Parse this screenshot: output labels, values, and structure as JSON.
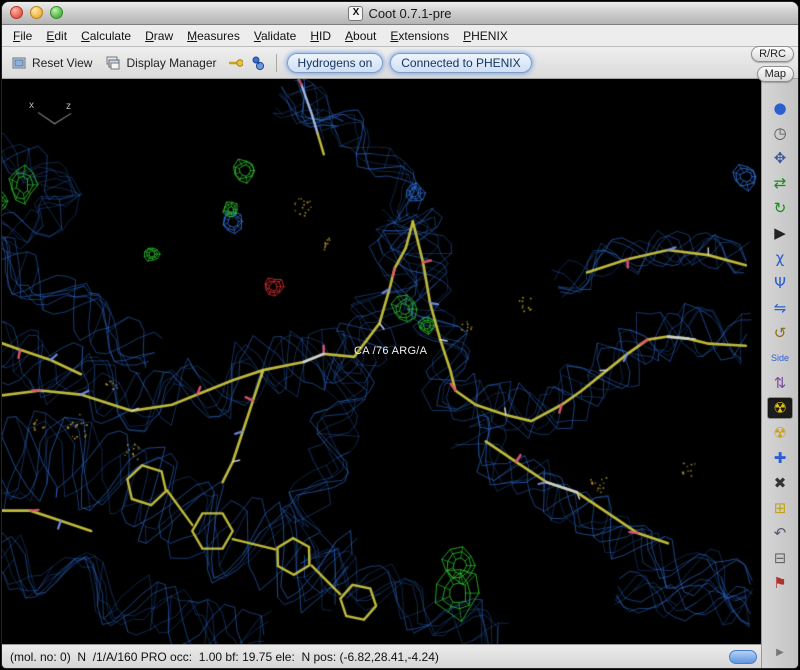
{
  "window": {
    "title": "Coot 0.7.1-pre"
  },
  "menubar": {
    "items": [
      {
        "name": "menu-file",
        "label": "File"
      },
      {
        "name": "menu-edit",
        "label": "Edit"
      },
      {
        "name": "menu-calculate",
        "label": "Calculate"
      },
      {
        "name": "menu-draw",
        "label": "Draw"
      },
      {
        "name": "menu-measures",
        "label": "Measures"
      },
      {
        "name": "menu-validate",
        "label": "Validate"
      },
      {
        "name": "menu-hid",
        "label": "HID"
      },
      {
        "name": "menu-about",
        "label": "About"
      },
      {
        "name": "menu-extensions",
        "label": "Extensions"
      },
      {
        "name": "menu-phenix",
        "label": "PHENIX"
      }
    ]
  },
  "toolbar": {
    "reset_view": "Reset View",
    "display_manager": "Display Manager",
    "hydrogens_toggle": "Hydrogens on",
    "phenix_status": "Connected to PHENIX"
  },
  "side_buttons": {
    "rrc": "R/RC",
    "map": "Map"
  },
  "right_toolbar": {
    "items": [
      {
        "name": "map-sphere-icon",
        "glyph": "●",
        "color": "#2b5fd0"
      },
      {
        "name": "clock-icon",
        "glyph": "◷",
        "color": "#555555"
      },
      {
        "name": "move-zone-icon",
        "glyph": "✥",
        "color": "#3b5998"
      },
      {
        "name": "real-space-refine-icon",
        "glyph": "⇄",
        "color": "#1a8a1a"
      },
      {
        "name": "regularize-zone-icon",
        "glyph": "↻",
        "color": "#1a8a1a"
      },
      {
        "name": "pointer-icon",
        "glyph": "▶",
        "color": "#222222"
      },
      {
        "name": "chi-angles-icon",
        "glyph": "χ",
        "color": "#2b5fd0"
      },
      {
        "name": "rotamers-icon",
        "glyph": "Ψ",
        "color": "#2b5fd0"
      },
      {
        "name": "flip-peptide-icon",
        "glyph": "⇋",
        "color": "#2b5fd0"
      },
      {
        "name": "backrub-rotamer-icon",
        "glyph": "↺",
        "color": "#8a6d1a"
      },
      {
        "name": "side-chain-180-icon",
        "glyph": "Side",
        "color": "#2b5fd0"
      },
      {
        "name": "mutate-icon",
        "glyph": "⇅",
        "color": "#7a4aa0"
      },
      {
        "name": "refinement-active-icon",
        "glyph": "☢",
        "color": "#e3c11c",
        "bg": "#1c1c1c",
        "active": true
      },
      {
        "name": "radiation-icon",
        "glyph": "☢",
        "color": "#caa11b"
      },
      {
        "name": "add-terminal-residue-icon",
        "glyph": "✚",
        "color": "#2b5fd0"
      },
      {
        "name": "delete-item-icon",
        "glyph": "✖",
        "color": "#333333"
      },
      {
        "name": "add-atom-icon",
        "glyph": "⊞",
        "color": "#c2a21a"
      },
      {
        "name": "undo-icon",
        "glyph": "↶",
        "color": "#555577"
      },
      {
        "name": "trash-icon",
        "glyph": "⊟",
        "color": "#666666"
      },
      {
        "name": "display-flag-icon",
        "glyph": "⚑",
        "color": "#b03030"
      },
      {
        "name": "toolbar-overflow-icon",
        "glyph": "▶",
        "color": "#777777",
        "overflow": true
      }
    ]
  },
  "canvas": {
    "atom_label": "CA /76 ARG/A",
    "axes": {
      "x": "x",
      "z": "z"
    }
  },
  "statusbar": {
    "text": "(mol. no: 0)  N  /1/A/160 PRO occ:  1.00 bf: 19.75 ele:  N pos: (-6.82,28.41,-4.24)"
  },
  "colors": {
    "mesh_blue": "#3072dc",
    "diff_green": "#2cc42c",
    "diff_red": "#d03030",
    "stick_yellow": "#c9c33e",
    "oxygen_red": "#e2556e",
    "nitrogen_blue": "#7590e8",
    "hydrogen_white": "#d4dae4",
    "dot_yellow": "#bb9a2e"
  }
}
